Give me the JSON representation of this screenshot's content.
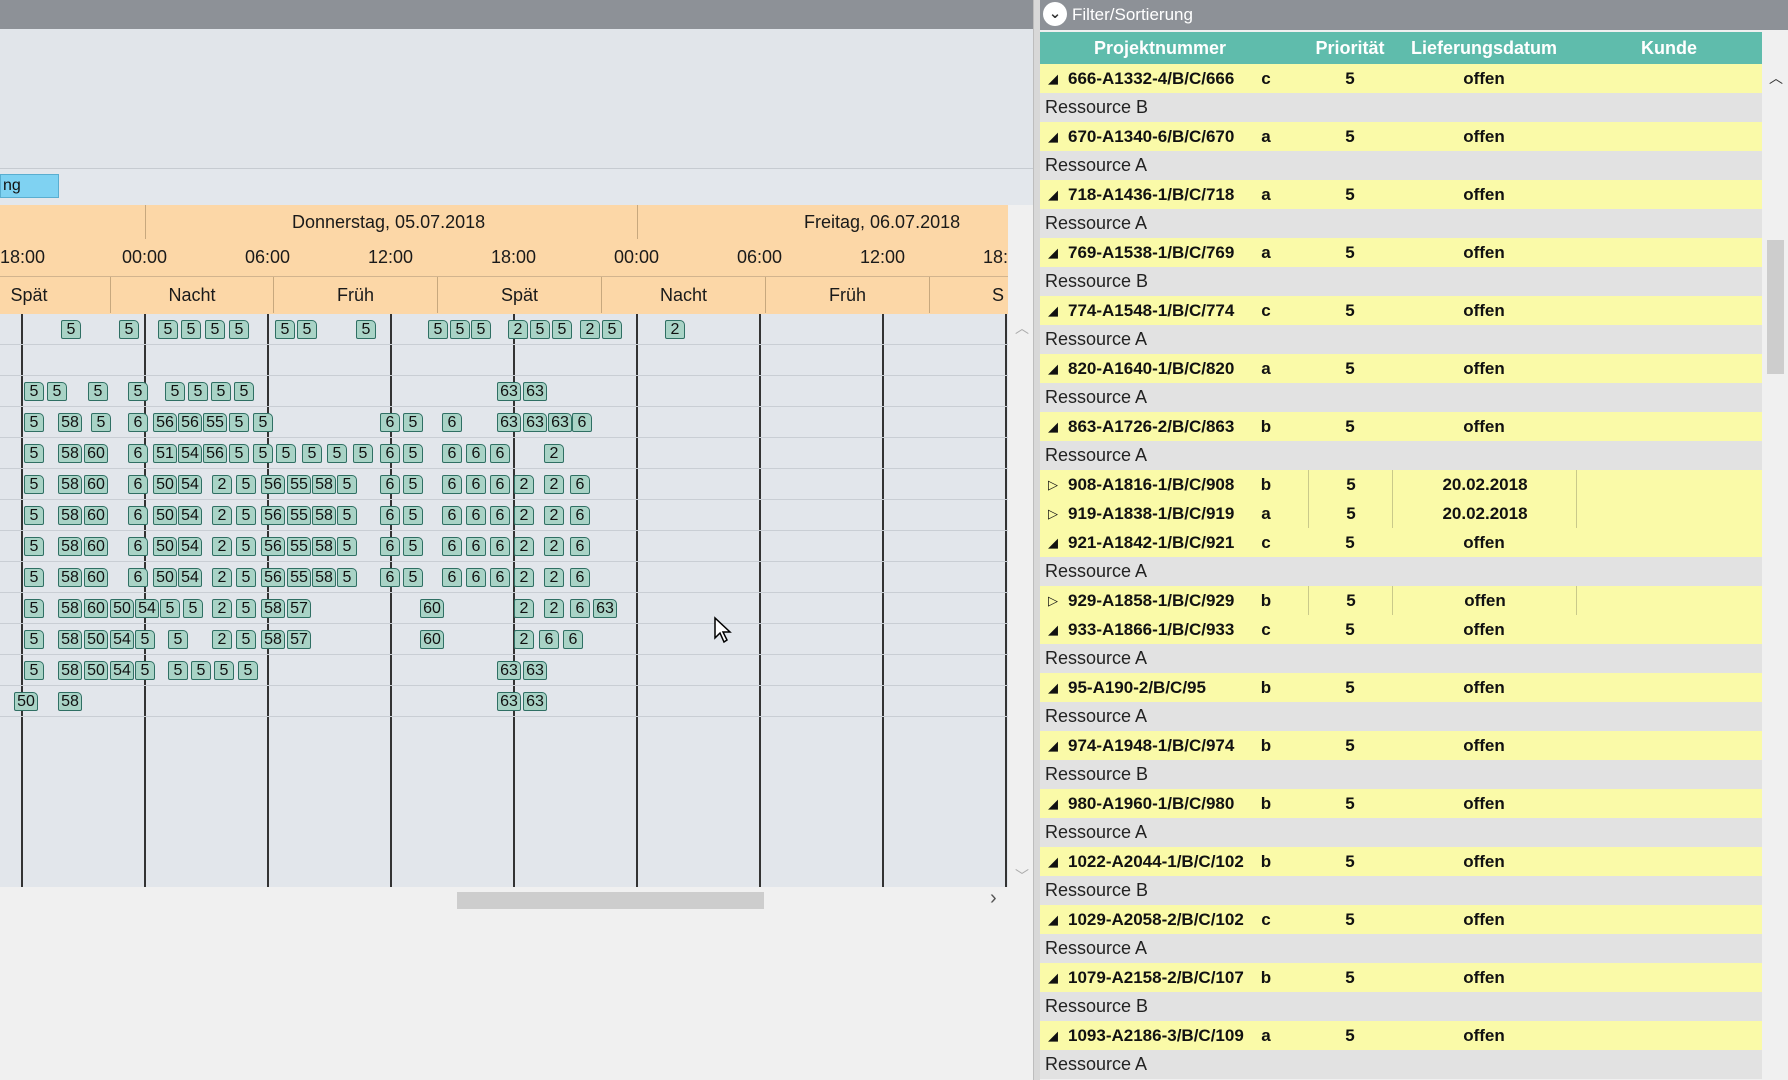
{
  "gantt": {
    "tab_label": "ng",
    "days": [
      "Donnerstag, 05.07.2018",
      "Freitag, 06.07.2018"
    ],
    "times": [
      "18:00",
      "00:00",
      "06:00",
      "12:00",
      "18:00",
      "00:00",
      "06:00",
      "12:00",
      "18:"
    ],
    "shifts": [
      "Spät",
      "Nacht",
      "Früh",
      "Spät",
      "Nacht",
      "Früh",
      "S"
    ],
    "rows": [
      [
        [
          61,
          "5"
        ],
        [
          119,
          "5"
        ],
        [
          158,
          "5"
        ],
        [
          181,
          "5"
        ],
        [
          205,
          "5"
        ],
        [
          229,
          "5"
        ],
        [
          275,
          "5"
        ],
        [
          297,
          "5"
        ],
        [
          356,
          "5"
        ],
        [
          428,
          "5"
        ],
        [
          450,
          "5"
        ],
        [
          471,
          "5"
        ],
        [
          508,
          "2"
        ],
        [
          530,
          "5"
        ],
        [
          552,
          "5"
        ],
        [
          580,
          "2"
        ],
        [
          602,
          "5"
        ],
        [
          665,
          "2"
        ]
      ],
      [],
      [
        [
          24,
          "5"
        ],
        [
          47,
          "5"
        ],
        [
          88,
          "5"
        ],
        [
          128,
          "5"
        ],
        [
          165,
          "5"
        ],
        [
          188,
          "5"
        ],
        [
          211,
          "5"
        ],
        [
          234,
          "5"
        ],
        [
          497,
          "63"
        ],
        [
          523,
          "63"
        ]
      ],
      [
        [
          24,
          "5"
        ],
        [
          58,
          "58"
        ],
        [
          91,
          "5"
        ],
        [
          128,
          "6"
        ],
        [
          153,
          "56"
        ],
        [
          178,
          "56"
        ],
        [
          203,
          "55"
        ],
        [
          229,
          "5"
        ],
        [
          253,
          "5"
        ],
        [
          380,
          "6"
        ],
        [
          403,
          "5"
        ],
        [
          442,
          "6"
        ],
        [
          497,
          "63"
        ],
        [
          523,
          "63"
        ],
        [
          548,
          "63"
        ],
        [
          572,
          "6"
        ]
      ],
      [
        [
          24,
          "5"
        ],
        [
          58,
          "58"
        ],
        [
          84,
          "60"
        ],
        [
          128,
          "6"
        ],
        [
          153,
          "51"
        ],
        [
          178,
          "54"
        ],
        [
          203,
          "56"
        ],
        [
          229,
          "5"
        ],
        [
          253,
          "5"
        ],
        [
          276,
          "5"
        ],
        [
          302,
          "5"
        ],
        [
          327,
          "5"
        ],
        [
          353,
          "5"
        ],
        [
          380,
          "6"
        ],
        [
          403,
          "5"
        ],
        [
          442,
          "6"
        ],
        [
          466,
          "6"
        ],
        [
          490,
          "6"
        ],
        [
          544,
          "2"
        ]
      ],
      [
        [
          24,
          "5"
        ],
        [
          58,
          "58"
        ],
        [
          84,
          "60"
        ],
        [
          128,
          "6"
        ],
        [
          153,
          "50"
        ],
        [
          178,
          "54"
        ],
        [
          212,
          "2"
        ],
        [
          236,
          "5"
        ],
        [
          261,
          "56"
        ],
        [
          287,
          "55"
        ],
        [
          312,
          "58"
        ],
        [
          337,
          "5"
        ],
        [
          380,
          "6"
        ],
        [
          403,
          "5"
        ],
        [
          442,
          "6"
        ],
        [
          466,
          "6"
        ],
        [
          490,
          "6"
        ],
        [
          514,
          "2"
        ],
        [
          544,
          "2"
        ],
        [
          570,
          "6"
        ]
      ],
      [
        [
          24,
          "5"
        ],
        [
          58,
          "58"
        ],
        [
          84,
          "60"
        ],
        [
          128,
          "6"
        ],
        [
          153,
          "50"
        ],
        [
          178,
          "54"
        ],
        [
          212,
          "2"
        ],
        [
          236,
          "5"
        ],
        [
          261,
          "56"
        ],
        [
          287,
          "55"
        ],
        [
          312,
          "58"
        ],
        [
          337,
          "5"
        ],
        [
          380,
          "6"
        ],
        [
          403,
          "5"
        ],
        [
          442,
          "6"
        ],
        [
          466,
          "6"
        ],
        [
          490,
          "6"
        ],
        [
          514,
          "2"
        ],
        [
          544,
          "2"
        ],
        [
          570,
          "6"
        ]
      ],
      [
        [
          24,
          "5"
        ],
        [
          58,
          "58"
        ],
        [
          84,
          "60"
        ],
        [
          128,
          "6"
        ],
        [
          153,
          "50"
        ],
        [
          178,
          "54"
        ],
        [
          212,
          "2"
        ],
        [
          236,
          "5"
        ],
        [
          261,
          "56"
        ],
        [
          287,
          "55"
        ],
        [
          312,
          "58"
        ],
        [
          337,
          "5"
        ],
        [
          380,
          "6"
        ],
        [
          403,
          "5"
        ],
        [
          442,
          "6"
        ],
        [
          466,
          "6"
        ],
        [
          490,
          "6"
        ],
        [
          514,
          "2"
        ],
        [
          544,
          "2"
        ],
        [
          570,
          "6"
        ]
      ],
      [
        [
          24,
          "5"
        ],
        [
          58,
          "58"
        ],
        [
          84,
          "60"
        ],
        [
          128,
          "6"
        ],
        [
          153,
          "50"
        ],
        [
          178,
          "54"
        ],
        [
          212,
          "2"
        ],
        [
          236,
          "5"
        ],
        [
          261,
          "56"
        ],
        [
          287,
          "55"
        ],
        [
          312,
          "58"
        ],
        [
          337,
          "5"
        ],
        [
          380,
          "6"
        ],
        [
          403,
          "5"
        ],
        [
          442,
          "6"
        ],
        [
          466,
          "6"
        ],
        [
          490,
          "6"
        ],
        [
          514,
          "2"
        ],
        [
          544,
          "2"
        ],
        [
          570,
          "6"
        ]
      ],
      [
        [
          24,
          "5"
        ],
        [
          58,
          "58"
        ],
        [
          84,
          "60"
        ],
        [
          110,
          "50"
        ],
        [
          135,
          "54"
        ],
        [
          160,
          "5"
        ],
        [
          183,
          "5"
        ],
        [
          212,
          "2"
        ],
        [
          236,
          "5"
        ],
        [
          261,
          "58"
        ],
        [
          287,
          "57"
        ],
        [
          420,
          "60"
        ],
        [
          514,
          "2"
        ],
        [
          544,
          "2"
        ],
        [
          570,
          "6"
        ],
        [
          593,
          "63"
        ]
      ],
      [
        [
          24,
          "5"
        ],
        [
          58,
          "58"
        ],
        [
          84,
          "50"
        ],
        [
          110,
          "54"
        ],
        [
          135,
          "5"
        ],
        [
          168,
          "5"
        ],
        [
          212,
          "2"
        ],
        [
          236,
          "5"
        ],
        [
          261,
          "58"
        ],
        [
          287,
          "57"
        ],
        [
          420,
          "60"
        ],
        [
          514,
          "2"
        ],
        [
          539,
          "6"
        ],
        [
          563,
          "6"
        ]
      ],
      [
        [
          24,
          "5"
        ],
        [
          58,
          "58"
        ],
        [
          84,
          "50"
        ],
        [
          110,
          "54"
        ],
        [
          135,
          "5"
        ],
        [
          168,
          "5"
        ],
        [
          191,
          "5"
        ],
        [
          214,
          "5"
        ],
        [
          238,
          "5"
        ],
        [
          497,
          "63"
        ],
        [
          523,
          "63"
        ]
      ],
      [
        [
          14,
          "50"
        ],
        [
          58,
          "58"
        ],
        [
          497,
          "63"
        ],
        [
          523,
          "63"
        ]
      ]
    ]
  },
  "filter": {
    "label": "Filter/Sortierung",
    "icon": "chevron-down-icon"
  },
  "table": {
    "headers": [
      "Projektnummer",
      "Priorität",
      "Lieferungsdatum",
      "Kunde"
    ],
    "rows": [
      {
        "type": "proj",
        "expander": "open",
        "nr": "666-A1332-4/B/C/666",
        "cls": "c",
        "prio": "5",
        "date": "offen",
        "kunde": ""
      },
      {
        "type": "grp",
        "label": "Ressource B"
      },
      {
        "type": "proj",
        "expander": "open",
        "nr": "670-A1340-6/B/C/670",
        "cls": "a",
        "prio": "5",
        "date": "offen",
        "kunde": ""
      },
      {
        "type": "grp",
        "label": "Ressource A"
      },
      {
        "type": "proj",
        "expander": "open",
        "nr": "718-A1436-1/B/C/718",
        "cls": "a",
        "prio": "5",
        "date": "offen",
        "kunde": ""
      },
      {
        "type": "grp",
        "label": "Ressource A"
      },
      {
        "type": "proj",
        "expander": "open",
        "nr": "769-A1538-1/B/C/769",
        "cls": "a",
        "prio": "5",
        "date": "offen",
        "kunde": ""
      },
      {
        "type": "grp",
        "label": "Ressource B"
      },
      {
        "type": "proj",
        "expander": "open",
        "nr": "774-A1548-1/B/C/774",
        "cls": "c",
        "prio": "5",
        "date": "offen",
        "kunde": ""
      },
      {
        "type": "grp",
        "label": "Ressource A"
      },
      {
        "type": "proj",
        "expander": "open",
        "nr": "820-A1640-1/B/C/820",
        "cls": "a",
        "prio": "5",
        "date": "offen",
        "kunde": ""
      },
      {
        "type": "grp",
        "label": "Ressource A"
      },
      {
        "type": "proj",
        "expander": "open",
        "nr": "863-A1726-2/B/C/863",
        "cls": "b",
        "prio": "5",
        "date": "offen",
        "kunde": ""
      },
      {
        "type": "grp",
        "label": "Ressource A"
      },
      {
        "type": "proj",
        "expander": "closed",
        "nr": "908-A1816-1/B/C/908",
        "cls": "b",
        "prio": "5",
        "date": "20.02.2018",
        "kunde": ""
      },
      {
        "type": "proj",
        "expander": "closed",
        "nr": "919-A1838-1/B/C/919",
        "cls": "a",
        "prio": "5",
        "date": "20.02.2018",
        "kunde": ""
      },
      {
        "type": "proj",
        "expander": "open",
        "nr": "921-A1842-1/B/C/921",
        "cls": "c",
        "prio": "5",
        "date": "offen",
        "kunde": ""
      },
      {
        "type": "grp",
        "label": "Ressource A"
      },
      {
        "type": "proj",
        "expander": "closed",
        "nr": "929-A1858-1/B/C/929",
        "cls": "b",
        "prio": "5",
        "date": "offen",
        "kunde": ""
      },
      {
        "type": "proj",
        "expander": "open",
        "nr": "933-A1866-1/B/C/933",
        "cls": "c",
        "prio": "5",
        "date": "offen",
        "kunde": ""
      },
      {
        "type": "grp",
        "label": "Ressource A"
      },
      {
        "type": "proj",
        "expander": "open",
        "nr": "95-A190-2/B/C/95",
        "cls": "b",
        "prio": "5",
        "date": "offen",
        "kunde": ""
      },
      {
        "type": "grp",
        "label": "Ressource A"
      },
      {
        "type": "proj",
        "expander": "open",
        "nr": "974-A1948-1/B/C/974",
        "cls": "b",
        "prio": "5",
        "date": "offen",
        "kunde": ""
      },
      {
        "type": "grp",
        "label": "Ressource B"
      },
      {
        "type": "proj",
        "expander": "open",
        "nr": "980-A1960-1/B/C/980",
        "cls": "b",
        "prio": "5",
        "date": "offen",
        "kunde": ""
      },
      {
        "type": "grp",
        "label": "Ressource A"
      },
      {
        "type": "proj",
        "expander": "open",
        "nr": "1022-A2044-1/B/C/102",
        "cls": "b",
        "prio": "5",
        "date": "offen",
        "kunde": ""
      },
      {
        "type": "grp",
        "label": "Ressource B"
      },
      {
        "type": "proj",
        "expander": "open",
        "nr": "1029-A2058-2/B/C/102",
        "cls": "c",
        "prio": "5",
        "date": "offen",
        "kunde": ""
      },
      {
        "type": "grp",
        "label": "Ressource A"
      },
      {
        "type": "proj",
        "expander": "open",
        "nr": "1079-A2158-2/B/C/107",
        "cls": "b",
        "prio": "5",
        "date": "offen",
        "kunde": ""
      },
      {
        "type": "grp",
        "label": "Ressource B"
      },
      {
        "type": "proj",
        "expander": "open",
        "nr": "1093-A2186-3/B/C/109",
        "cls": "a",
        "prio": "5",
        "date": "offen",
        "kunde": ""
      },
      {
        "type": "grp",
        "label": "Ressource A"
      }
    ]
  },
  "colors": {
    "header_teal": "#5fbcac",
    "row_yellow": "#fafaa8",
    "group_grey": "#e2e2e2",
    "timeline_orange": "#fcd7a7",
    "chip_fill": "#a9d3c6"
  }
}
